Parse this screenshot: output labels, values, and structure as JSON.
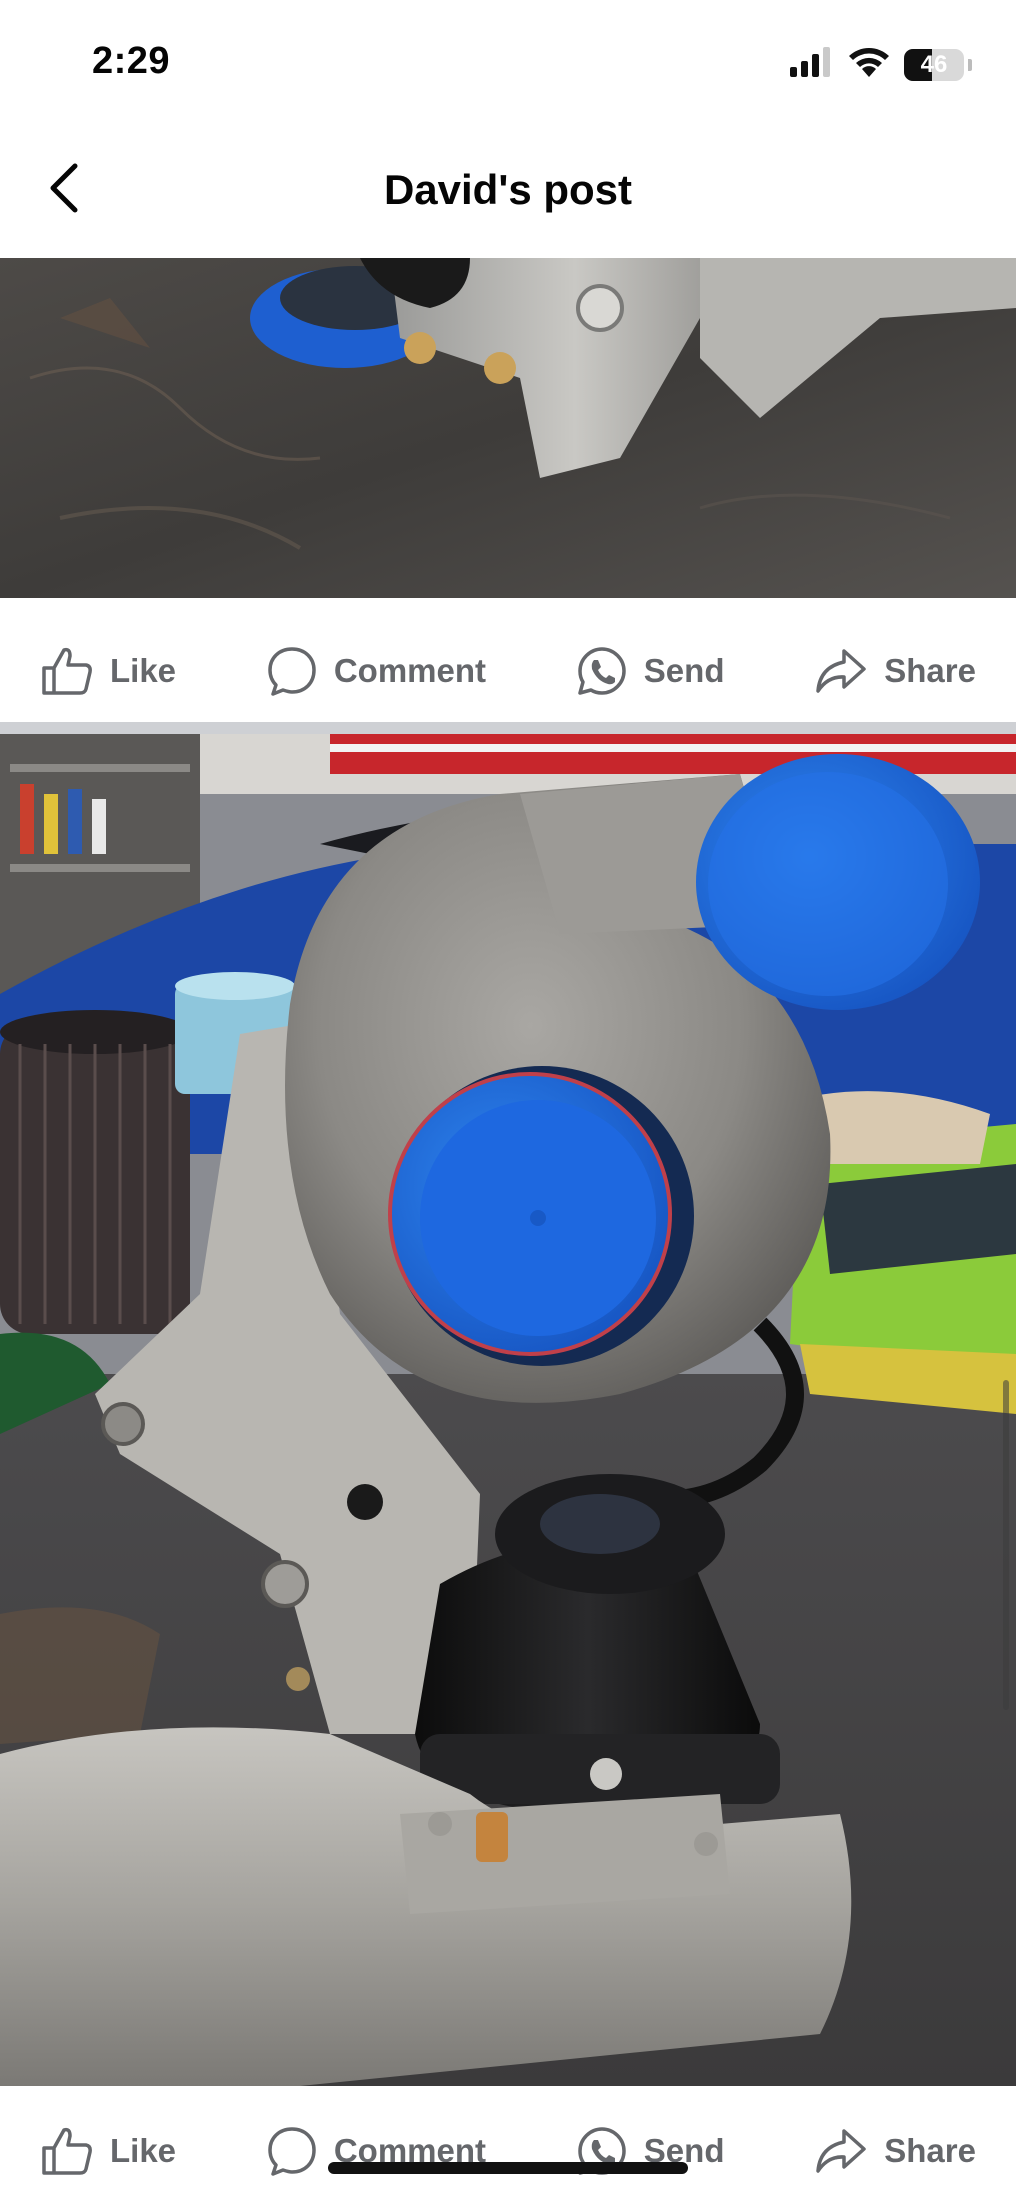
{
  "status_bar": {
    "time": "2:29",
    "battery_level": "46",
    "battery_fraction": 0.46
  },
  "nav": {
    "title": "David's post"
  },
  "actions": {
    "like": "Like",
    "comment": "Comment",
    "send": "Send",
    "share": "Share"
  },
  "colors": {
    "action_text": "#65676b",
    "divider": "#ced0d4",
    "cap_blue": "#1f6fe0"
  }
}
